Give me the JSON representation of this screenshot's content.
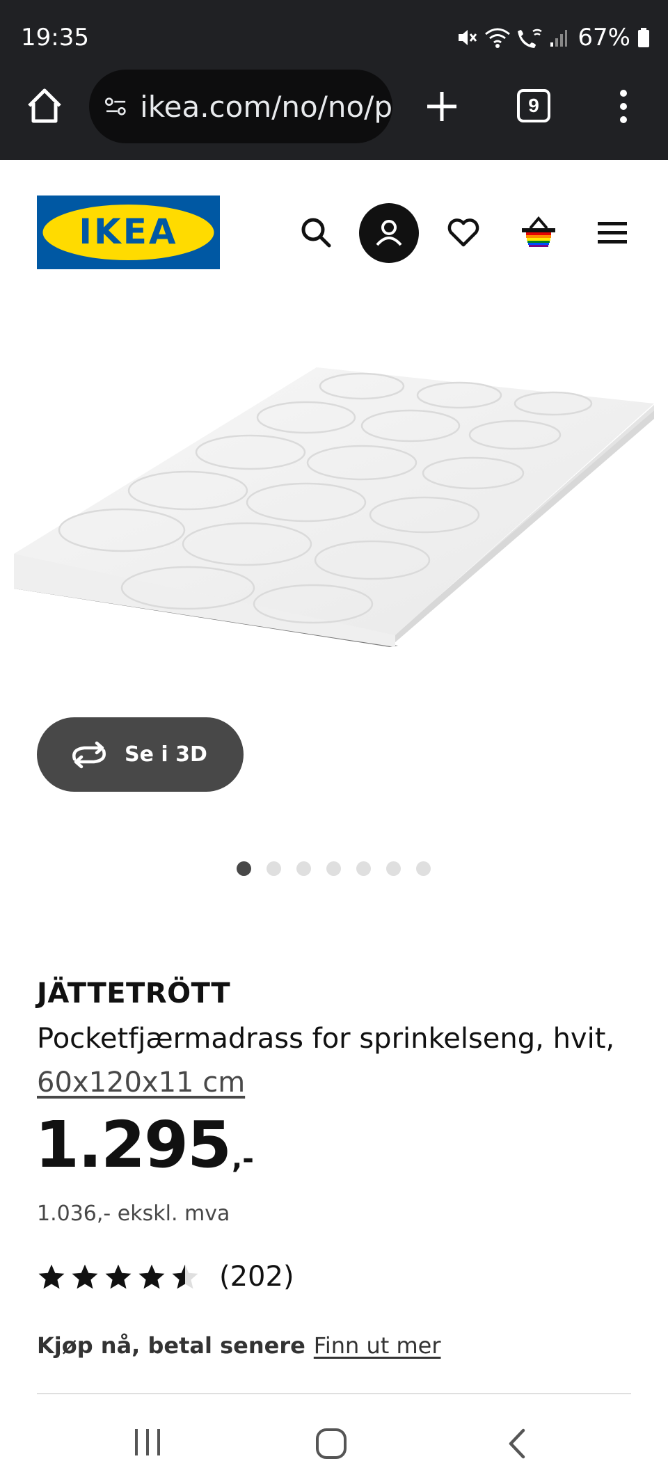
{
  "status_bar": {
    "time": "19:35",
    "battery": "67%"
  },
  "browser": {
    "url": "ikea.com/no/no/p",
    "tab_count": "9"
  },
  "brand": {
    "logo_text": "IKEA",
    "brand_blue": "#0058a3",
    "brand_yellow": "#ffdb00"
  },
  "header": {
    "icons": [
      "search-icon",
      "user-icon",
      "heart-icon",
      "cart-icon",
      "menu-icon"
    ]
  },
  "gallery": {
    "view_3d_label": "Se i 3D",
    "image_count": 7,
    "active_index": 0
  },
  "product": {
    "name": "JÄTTETRÖTT",
    "description": "Pocketfjærmadrass for sprinkelseng, hvit,",
    "size": "60x120x11 cm",
    "price_main": "1.295",
    "price_suffix": ",-",
    "price_ex_vat": "1.036,- ekskl. mva",
    "rating": 4.5,
    "review_count": "(202)"
  },
  "bnpl": {
    "label": "Kjøp nå, betal senere",
    "link": "Finn ut mer"
  },
  "colors": {
    "chrome_bg": "#202124",
    "button_dark": "#484848",
    "divider": "#dfdfdf"
  }
}
